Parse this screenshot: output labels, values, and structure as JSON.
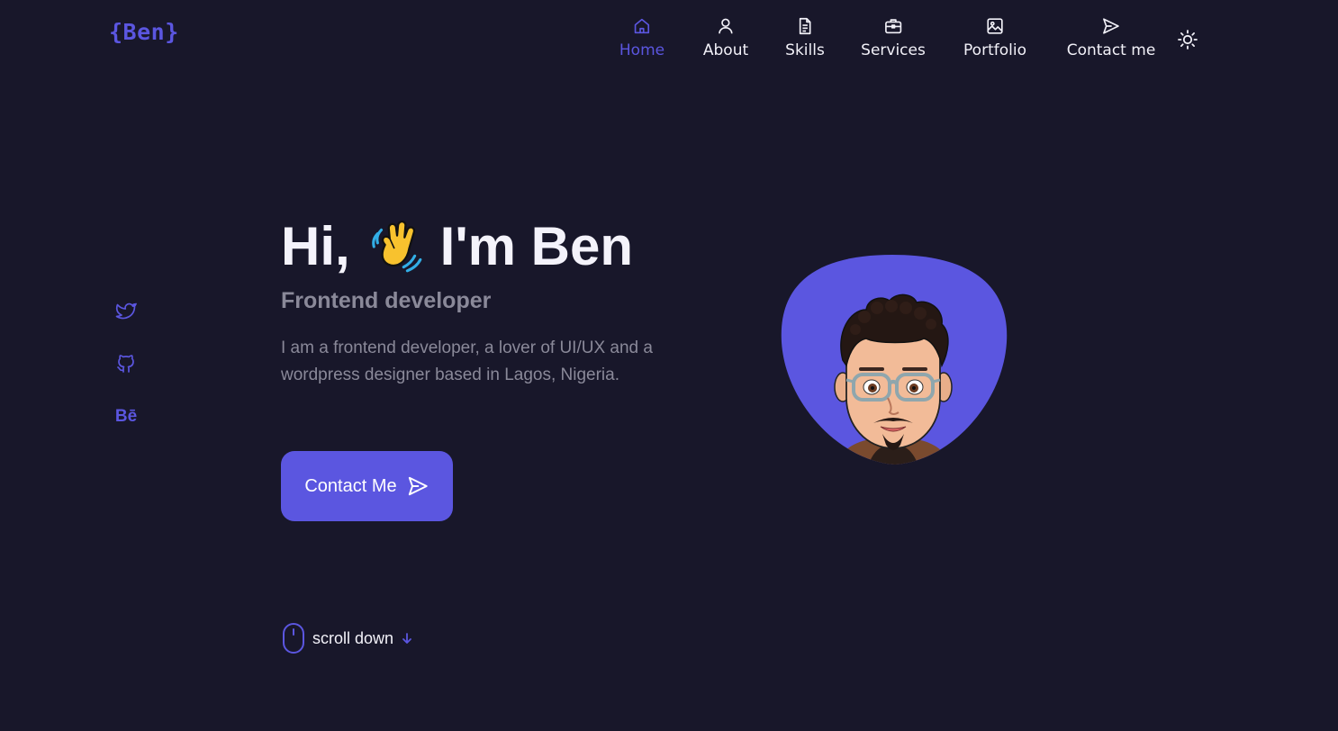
{
  "brand": {
    "logo": "{Ben}",
    "accent": "#5b56e0",
    "background": "#18172a"
  },
  "nav": {
    "items": [
      {
        "label": "Home",
        "icon": "home-icon",
        "active": true
      },
      {
        "label": "About",
        "icon": "user-icon",
        "active": false
      },
      {
        "label": "Skills",
        "icon": "file-text-icon",
        "active": false
      },
      {
        "label": "Services",
        "icon": "briefcase-icon",
        "active": false
      },
      {
        "label": "Portfolio",
        "icon": "image-icon",
        "active": false
      },
      {
        "label": "Contact me",
        "icon": "send-icon",
        "active": false
      }
    ],
    "theme_toggle_icon": "sun-icon"
  },
  "social": [
    {
      "name": "twitter",
      "icon": "twitter-icon"
    },
    {
      "name": "github",
      "icon": "github-icon"
    },
    {
      "name": "behance",
      "icon": "behance-icon",
      "glyph": "Bē"
    }
  ],
  "hero": {
    "greeting": "Hi,",
    "wave_icon": "waving-hand-icon",
    "name": "I'm Ben",
    "subtitle": "Frontend developer",
    "description": "I am a frontend developer, a lover of UI/UX and a wordpress designer based in Lagos, Nigeria.",
    "cta_label": "Contact Me",
    "cta_icon": "send-icon"
  },
  "scroll": {
    "label": "scroll down",
    "icon": "mouse-icon",
    "arrow_icon": "arrow-down-icon"
  },
  "avatar": {
    "blob_color": "#5b56e0",
    "icon": "avatar-illustration"
  }
}
